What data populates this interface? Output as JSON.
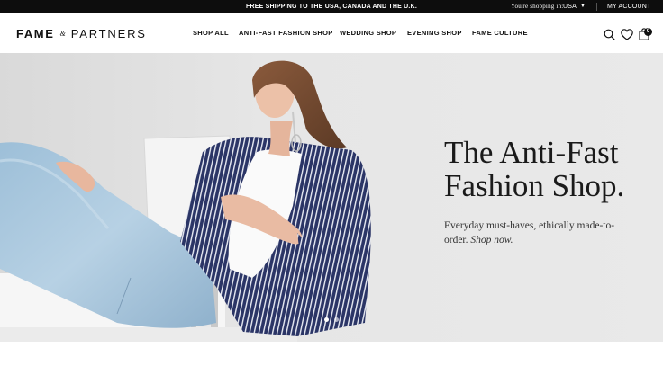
{
  "topbar": {
    "shipping": "FREE SHIPPING TO THE USA, CANADA AND THE U.K.",
    "shopping_in": "You're shopping in:",
    "country": "USA",
    "account": "MY ACCOUNT"
  },
  "header": {
    "logo": {
      "left": "FAME",
      "mark": "&",
      "right": "PARTNERS"
    },
    "nav": [
      "SHOP ALL",
      "ANTI-FAST FASHION SHOP",
      "WEDDING SHOP",
      "EVENING SHOP",
      "FAME CULTURE"
    ],
    "icons": [
      "search-icon",
      "heart-icon",
      "shopping-bag-icon"
    ],
    "bag_count": "0"
  },
  "hero": {
    "title_line1": "The Anti-Fast",
    "title_line2": "Fashion Shop.",
    "subtitle": "Everyday must-haves, ethically made-to-order.",
    "cta": "Shop now.",
    "slide_current": 1,
    "slide_total": 2
  },
  "colors": {
    "topbar_bg": "#0d0d0d",
    "hero_bg": "#e6e6e6",
    "text": "#111111"
  }
}
